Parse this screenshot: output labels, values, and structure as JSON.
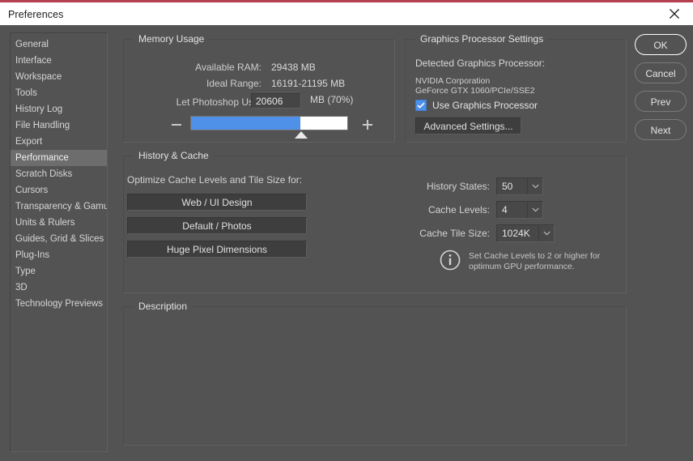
{
  "window": {
    "title": "Preferences",
    "close_icon": "close-icon",
    "accent_color": "#b44050"
  },
  "sidebar": {
    "items": [
      {
        "label": "General",
        "selected": false
      },
      {
        "label": "Interface",
        "selected": false
      },
      {
        "label": "Workspace",
        "selected": false
      },
      {
        "label": "Tools",
        "selected": false
      },
      {
        "label": "History Log",
        "selected": false
      },
      {
        "label": "File Handling",
        "selected": false
      },
      {
        "label": "Export",
        "selected": false
      },
      {
        "label": "Performance",
        "selected": true
      },
      {
        "label": "Scratch Disks",
        "selected": false
      },
      {
        "label": "Cursors",
        "selected": false
      },
      {
        "label": "Transparency & Gamut",
        "selected": false
      },
      {
        "label": "Units & Rulers",
        "selected": false
      },
      {
        "label": "Guides, Grid & Slices",
        "selected": false
      },
      {
        "label": "Plug-Ins",
        "selected": false
      },
      {
        "label": "Type",
        "selected": false
      },
      {
        "label": "3D",
        "selected": false
      },
      {
        "label": "Technology Previews",
        "selected": false
      }
    ]
  },
  "memory_usage": {
    "group_label": "Memory Usage",
    "available_ram_label": "Available RAM:",
    "available_ram_value": "29438 MB",
    "ideal_range_label": "Ideal Range:",
    "ideal_range_value": "16191-21195 MB",
    "let_use_label": "Let Photoshop Use:",
    "let_use_value": "20606",
    "let_use_unit": "MB (70%)",
    "slider_percent": 70,
    "slider_fill_color": "#4f90e8",
    "minus_icon": "minus-icon",
    "plus_icon": "plus-icon"
  },
  "graphics": {
    "group_label": "Graphics Processor Settings",
    "detected_label": "Detected Graphics Processor:",
    "vendor": "NVIDIA Corporation",
    "model": "GeForce GTX 1060/PCIe/SSE2",
    "use_gpu_label": "Use Graphics Processor",
    "use_gpu_checked": true,
    "advanced_button": "Advanced Settings...",
    "checkbox_color": "#4f90e8"
  },
  "history_cache": {
    "group_label": "History & Cache",
    "optimize_label": "Optimize Cache Levels and Tile Size for:",
    "presets": [
      {
        "label": "Web / UI Design"
      },
      {
        "label": "Default / Photos"
      },
      {
        "label": "Huge Pixel Dimensions"
      }
    ],
    "history_states_label": "History States:",
    "history_states_value": "50",
    "cache_levels_label": "Cache Levels:",
    "cache_levels_value": "4",
    "cache_tile_label": "Cache Tile Size:",
    "cache_tile_value": "1024K",
    "info_icon": "info-icon",
    "info_text": "Set Cache Levels to 2 or higher for optimum GPU performance."
  },
  "description": {
    "group_label": "Description",
    "text": ""
  },
  "buttons": {
    "ok": "OK",
    "cancel": "Cancel",
    "prev": "Prev",
    "next": "Next"
  }
}
